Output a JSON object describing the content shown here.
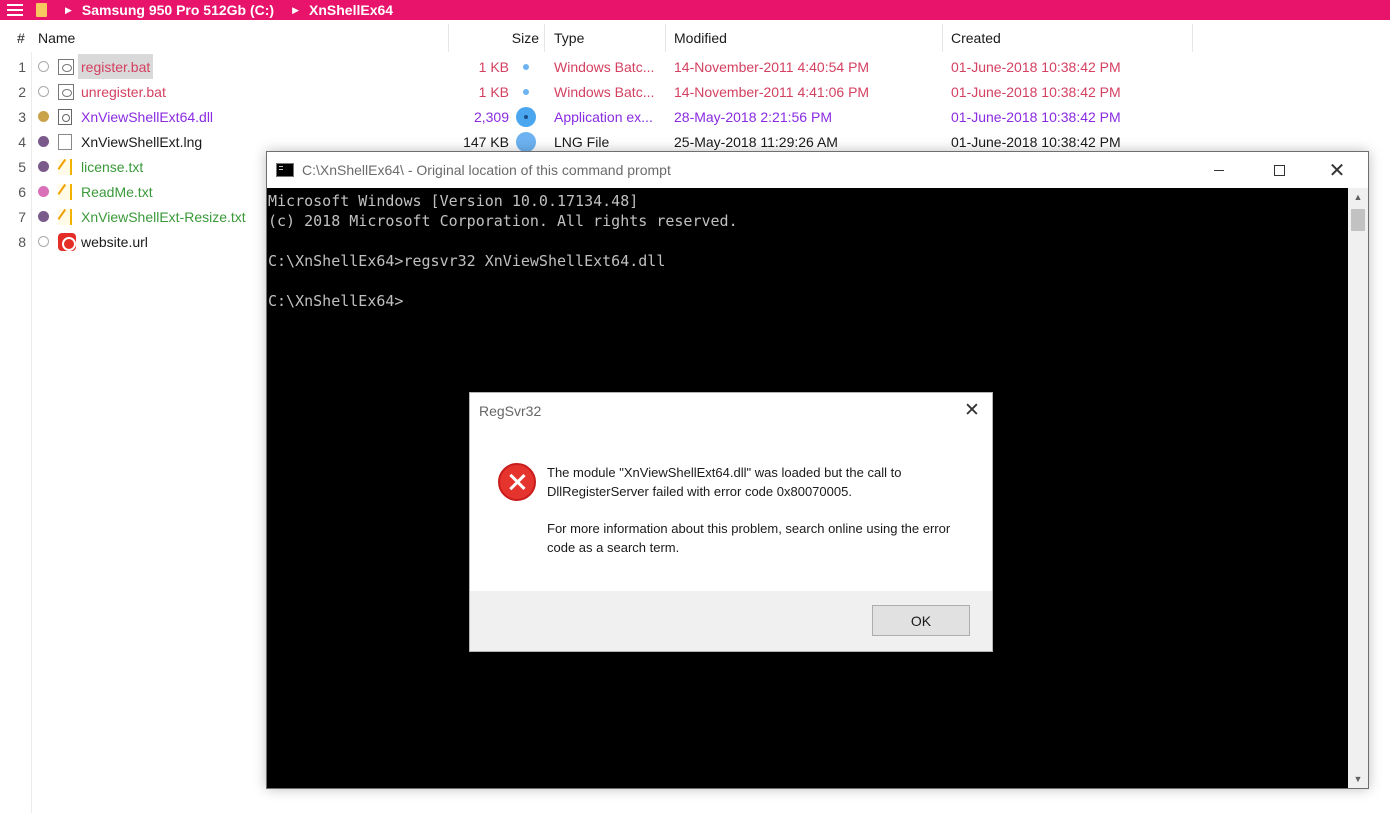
{
  "explorer": {
    "breadcrumb": [
      "Samsung 950 Pro 512Gb (C:)",
      "XnShellEx64"
    ],
    "columns": {
      "num": "#",
      "name": "Name",
      "size": "Size",
      "type": "Type",
      "modified": "Modified",
      "created": "Created"
    },
    "files": [
      {
        "num": "1",
        "name": "register.bat",
        "size": "1 KB",
        "type": "Windows Batc...",
        "modified": "14-November-2011 4:40:54 PM",
        "created": "01-June-2018 10:38:42 PM",
        "color": "#d44060",
        "dot_color": "",
        "icon": "bat-file-icon",
        "selected": true
      },
      {
        "num": "2",
        "name": "unregister.bat",
        "size": "1 KB",
        "type": "Windows Batc...",
        "modified": "14-November-2011 4:41:06 PM",
        "created": "01-June-2018 10:38:42 PM",
        "color": "#d44060",
        "dot_color": "",
        "icon": "bat-file-icon"
      },
      {
        "num": "3",
        "name": "XnViewShellExt64.dll",
        "size": "2,309",
        "type": "Application ex...",
        "modified": "28-May-2018 2:21:56 PM",
        "created": "01-June-2018 10:38:42 PM",
        "color": "#8a2be2",
        "dot_color": "#c9a24a",
        "icon": "dll-file-icon"
      },
      {
        "num": "4",
        "name": "XnViewShellExt.lng",
        "size": "147 KB",
        "type": "LNG File",
        "modified": "25-May-2018 11:29:26 AM",
        "created": "01-June-2018 10:38:42 PM",
        "color": "#1a1a1a",
        "dot_color": "#7a5a8a",
        "icon": "lng-file-icon"
      },
      {
        "num": "5",
        "name": "license.txt",
        "color": "#3a9a3a",
        "dot_color": "#7a5a8a",
        "icon": "text-file-icon"
      },
      {
        "num": "6",
        "name": "ReadMe.txt",
        "color": "#3a9a3a",
        "dot_color": "#d970b8",
        "icon": "text-file-icon"
      },
      {
        "num": "7",
        "name": "XnViewShellExt-Resize.txt",
        "color": "#3a9a3a",
        "dot_color": "#7a5a8a",
        "icon": "text-file-icon"
      },
      {
        "num": "8",
        "name": "website.url",
        "color": "#1a1a1a",
        "dot_color": "",
        "icon": "url-shortcut-icon"
      }
    ]
  },
  "cmd": {
    "title": "C:\\XnShellEx64\\ - Original location of this command prompt",
    "lines": [
      "Microsoft Windows [Version 10.0.17134.48]",
      "(c) 2018 Microsoft Corporation. All rights reserved.",
      "",
      "C:\\XnShellEx64>regsvr32 XnViewShellExt64.dll",
      "",
      "C:\\XnShellEx64>"
    ]
  },
  "dialog": {
    "title": "RegSvr32",
    "message1": "The module \"XnViewShellExt64.dll\" was loaded but the call to DllRegisterServer failed with error code 0x80070005.",
    "message2": "For more information about this problem, search online using the error code as a search term.",
    "ok_label": "OK"
  }
}
